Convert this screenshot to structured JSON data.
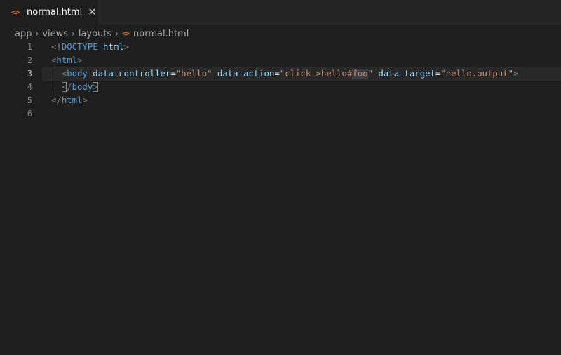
{
  "tab": {
    "icon": "<>",
    "label": "normal.html",
    "close": "✕"
  },
  "breadcrumb": {
    "parts": [
      "app",
      "views",
      "layouts"
    ],
    "file_icon": "<>",
    "file": "normal.html",
    "separator": "›"
  },
  "lines": {
    "numbers": [
      "1",
      "2",
      "3",
      "4",
      "5",
      "6"
    ],
    "l1": {
      "open": "<!",
      "doctype": "DOCTYPE",
      "space": " ",
      "html": "html",
      "close": ">"
    },
    "l2": {
      "open": "<",
      "tag": "html",
      "close": ">"
    },
    "l3": {
      "indent": "  ",
      "open": "<",
      "tag": "body",
      "attr1": "data-controller",
      "eq": "=",
      "val1": "\"hello\"",
      "attr2": "data-action",
      "val2a": "\"click->hello#",
      "val2b": "foo",
      "val2c": "\"",
      "attr3": "data-target",
      "val3": "\"hello.output\"",
      "close": ">"
    },
    "l4": {
      "indent": "  ",
      "open": "<",
      "slash": "/",
      "tag": "body",
      "close": ">"
    },
    "l5": {
      "open": "</",
      "tag": "html",
      "close": ">"
    }
  },
  "colors": {
    "background": "#1e1e1e",
    "tab_bar": "#252526",
    "file_icon": "#e37933",
    "tag": "#569cd6",
    "attribute": "#9cdcfe",
    "string": "#ce9178"
  }
}
